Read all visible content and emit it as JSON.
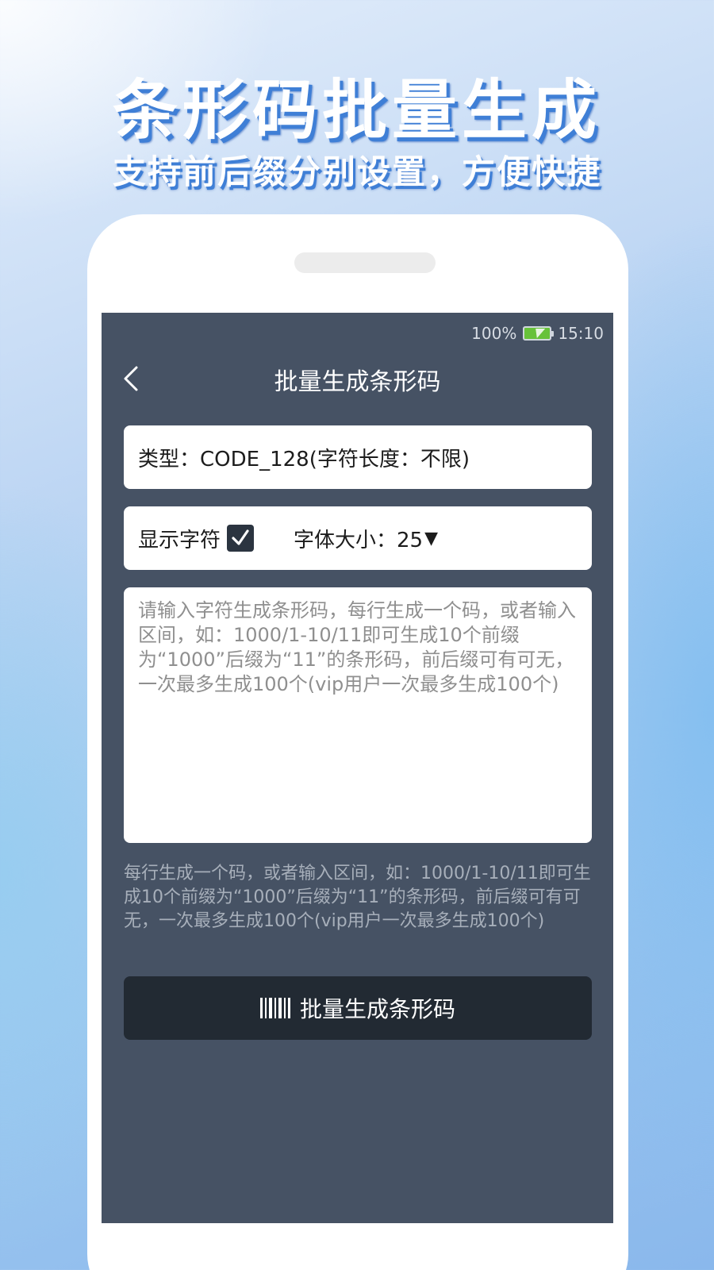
{
  "promo": {
    "title": "条形码批量生成",
    "subtitle": "支持前后缀分别设置，方便快捷"
  },
  "status_bar": {
    "battery_percent": "100%",
    "time": "15:10",
    "battery_icon": "battery-charging-icon"
  },
  "nav": {
    "back_icon": "chevron-left-icon",
    "title": "批量生成条形码"
  },
  "type_row": {
    "label": "类型：CODE_128(字符长度：不限)"
  },
  "options": {
    "show_chars_label": "显示字符",
    "show_chars_checked": true,
    "font_size_label": "字体大小：25",
    "font_size_caret": "▼"
  },
  "input": {
    "value": "",
    "placeholder": "请输入字符生成条形码，每行生成一个码，或者输入区间，如：1000/1-10/11即可生成10个前缀为“1000”后缀为“11”的条形码，前后缀可有可无，一次最多生成100个(vip用户一次最多生成100个)"
  },
  "hint": {
    "text": "每行生成一个码，或者输入区间，如：1000/1-10/11即可生成10个前缀为“1000”后缀为“11”的条形码，前后缀可有可无，一次最多生成100个(vip用户一次最多生成100个)"
  },
  "generate_button": {
    "label": "批量生成条形码",
    "icon": "barcode-icon"
  },
  "colors": {
    "screen_bg": "#465264",
    "button_bg": "#222a33",
    "title_shadow": "#3f7fd6",
    "battery_green": "#67c23a"
  }
}
